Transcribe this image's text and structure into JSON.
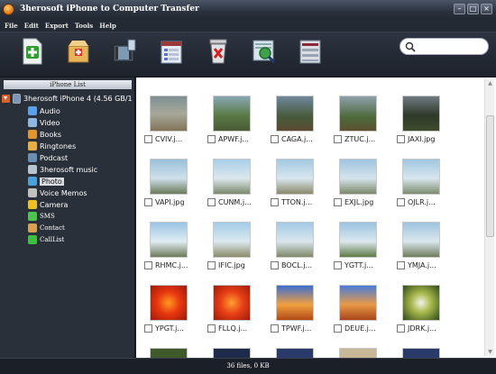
{
  "window": {
    "title": "3herosoft iPhone to Computer Transfer"
  },
  "menu": [
    "File",
    "Edit",
    "Export",
    "Tools",
    "Help"
  ],
  "toolbar": {
    "buttons": [
      "export-to-pc-icon",
      "import-from-pc-icon",
      "export-to-itunes-icon",
      "playlist-icon",
      "delete-icon",
      "search-filter-icon",
      "details-icon"
    ]
  },
  "search": {
    "placeholder": "",
    "value": ""
  },
  "sidebar": {
    "header": "iPhone List",
    "device": "3herosoft iPhone 4   (4.56 GB/1",
    "items": [
      {
        "label": "Audio",
        "icon": "audio-icon",
        "color": "#5aa0e8"
      },
      {
        "label": "Video",
        "icon": "video-icon",
        "color": "#8fb8e0"
      },
      {
        "label": "Books",
        "icon": "books-icon",
        "color": "#e0962a"
      },
      {
        "label": "Ringtones",
        "icon": "ringtones-icon",
        "color": "#e8b040"
      },
      {
        "label": "Podcast",
        "icon": "podcast-icon",
        "color": "#6a8fb5"
      },
      {
        "label": "3herosoft music",
        "icon": "playlist-icon",
        "color": "#b8c4d0"
      },
      {
        "label": "Photo",
        "icon": "photo-icon",
        "color": "#4aa0d8",
        "selected": true
      },
      {
        "label": "Voice Memos",
        "icon": "voice-memos-icon",
        "color": "#c0c0c0"
      },
      {
        "label": "Camera",
        "icon": "camera-icon",
        "color": "#f0c020"
      },
      {
        "label": "SMS",
        "icon": "sms-icon",
        "color": "#4ec44e"
      },
      {
        "label": "Contact",
        "icon": "contact-icon",
        "color": "#d8a050"
      },
      {
        "label": "CallList",
        "icon": "call-list-icon",
        "color": "#3fbf3f"
      }
    ]
  },
  "files": [
    [
      "CVIV.j...",
      "APWF.j...",
      "CAGA.j...",
      "ZTUC.j...",
      "JAXI.jpg"
    ],
    [
      "VAPI.jpg",
      "CUNM.j...",
      "TTON.j...",
      "EXJL.jpg",
      "OJLR.j..."
    ],
    [
      "RHMC.j...",
      "IFIC.jpg",
      "BOCL.j...",
      "YGTT.j...",
      "YMJA.j..."
    ],
    [
      "YPGT.j...",
      "FLLQ.j...",
      "TPWF.j...",
      "DEUE.j...",
      "JDRK.j..."
    ]
  ],
  "status": {
    "text": "36 files, 0 KB"
  }
}
